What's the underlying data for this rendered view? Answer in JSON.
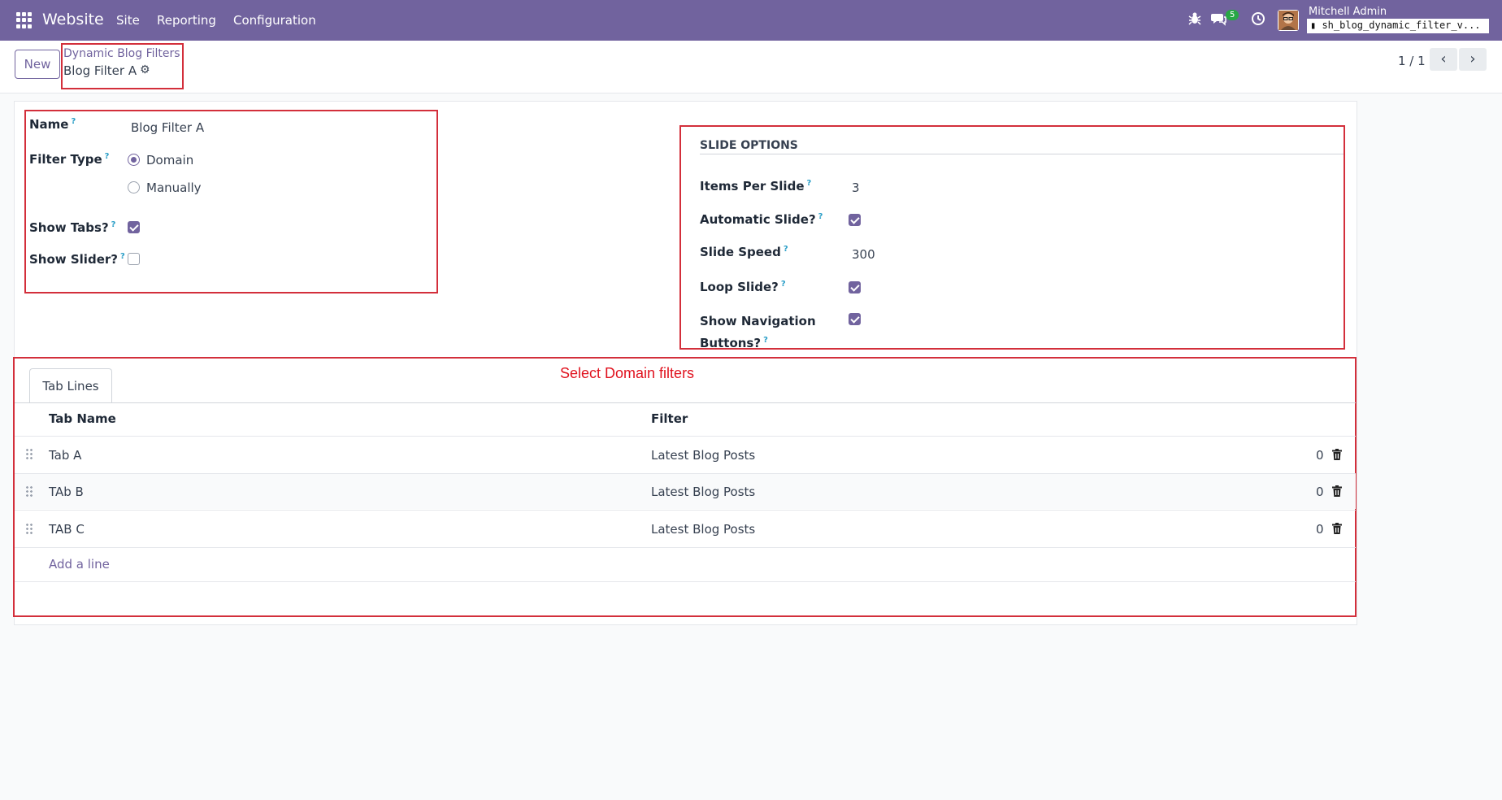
{
  "navbar": {
    "app_name": "Website",
    "menu": [
      "Site",
      "Reporting",
      "Configuration"
    ],
    "message_count": "5",
    "user_name": "Mitchell Admin",
    "database": "sh_blog_dynamic_filter_v..."
  },
  "control_panel": {
    "new_label": "New",
    "breadcrumb_parent": "Dynamic Blog Filters",
    "breadcrumb_current": "Blog Filter A",
    "pager": "1 / 1"
  },
  "form": {
    "name_label": "Name",
    "name_value": "Blog Filter A",
    "filter_type_label": "Filter Type",
    "filter_type_options": [
      "Domain",
      "Manually"
    ],
    "filter_type_selected": "Domain",
    "show_tabs_label": "Show Tabs?",
    "show_tabs": true,
    "show_slider_label": "Show Slider?",
    "show_slider": false,
    "help_mark": "?"
  },
  "slide_options": {
    "title": "SLIDE OPTIONS",
    "items_per_slide_label": "Items Per Slide",
    "items_per_slide": "3",
    "automatic_slide_label": "Automatic Slide?",
    "automatic_slide": true,
    "slide_speed_label": "Slide Speed",
    "slide_speed": "300",
    "loop_slide_label": "Loop Slide?",
    "loop_slide": true,
    "show_nav_label_line1": "Show Navigation",
    "show_nav_label_line2": "Buttons?",
    "show_nav": true
  },
  "annotation": "Select Domain filters",
  "tabs": [
    "Tab Lines"
  ],
  "tab_lines": {
    "columns": [
      "Tab Name",
      "Filter"
    ],
    "rows": [
      {
        "name": "Tab A",
        "filter": "Latest Blog Posts",
        "count": "0"
      },
      {
        "name": "TAb B",
        "filter": "Latest Blog Posts",
        "count": "0"
      },
      {
        "name": "TAB C",
        "filter": "Latest Blog Posts",
        "count": "0"
      }
    ],
    "add_line": "Add a line"
  },
  "colors": {
    "brand": "#71639e",
    "annotation": "#d32f3b",
    "help": "#2a9ec7",
    "badge": "#28a745"
  }
}
